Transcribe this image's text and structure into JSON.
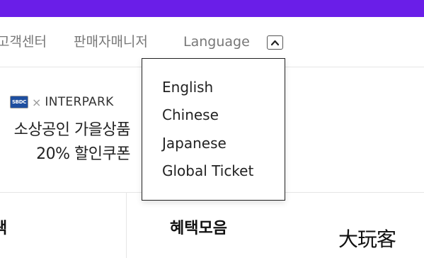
{
  "header": {
    "links": [
      {
        "label": "고객센터"
      },
      {
        "label": "판매자매니저"
      },
      {
        "label": "Language"
      }
    ]
  },
  "colors": {
    "top_bar": "#6a1ee8"
  },
  "language_menu": {
    "toggle_icon": "chevron-up-icon",
    "items": [
      {
        "label": "English"
      },
      {
        "label": "Chinese"
      },
      {
        "label": "Japanese"
      },
      {
        "label": "Global Ticket"
      }
    ]
  },
  "promo": {
    "partner_logo": "SBDC",
    "x_mark": "×",
    "brand": "INTERPARK",
    "line1": "소상공인 가을상품",
    "line2": "20% 할인쿠폰"
  },
  "sections": {
    "left_title": "색",
    "right_title": "혜택모음"
  },
  "watermark": {
    "text": "大玩客"
  }
}
